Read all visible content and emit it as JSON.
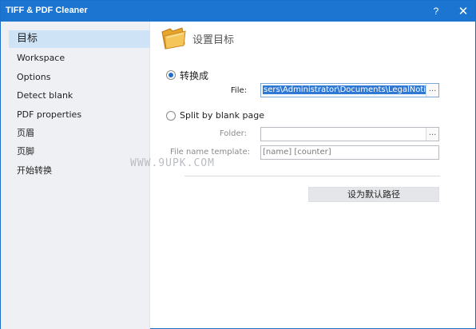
{
  "window": {
    "title": "TIFF & PDF Cleaner",
    "help_glyph": "?",
    "close_glyph": "✕",
    "accent_color": "#1c75d0"
  },
  "sidebar": {
    "items": [
      {
        "label": "目标",
        "active": true
      },
      {
        "label": "Workspace",
        "active": false
      },
      {
        "label": "Options",
        "active": false
      },
      {
        "label": "Detect blank",
        "active": false
      },
      {
        "label": "PDF properties",
        "active": false
      },
      {
        "label": "页眉",
        "active": false
      },
      {
        "label": "页脚",
        "active": false
      },
      {
        "label": "开始转换",
        "active": false
      }
    ]
  },
  "main": {
    "title": "设置目标",
    "title_icon": "folder-icon",
    "option_convert": {
      "label": "转换成",
      "selected": true
    },
    "file": {
      "label": "File:",
      "value": "sers\\Administrator\\Documents\\LegalNotices.pdf",
      "browse_label": "..."
    },
    "option_split": {
      "label": "Split by blank page",
      "selected": false
    },
    "folder": {
      "label": "Folder:",
      "value": "",
      "browse_label": "..."
    },
    "template": {
      "label": "File name template:",
      "value": "[name] [counter]"
    },
    "default_button": "设为默认路径"
  },
  "watermark": "WWW.9UPK.COM"
}
